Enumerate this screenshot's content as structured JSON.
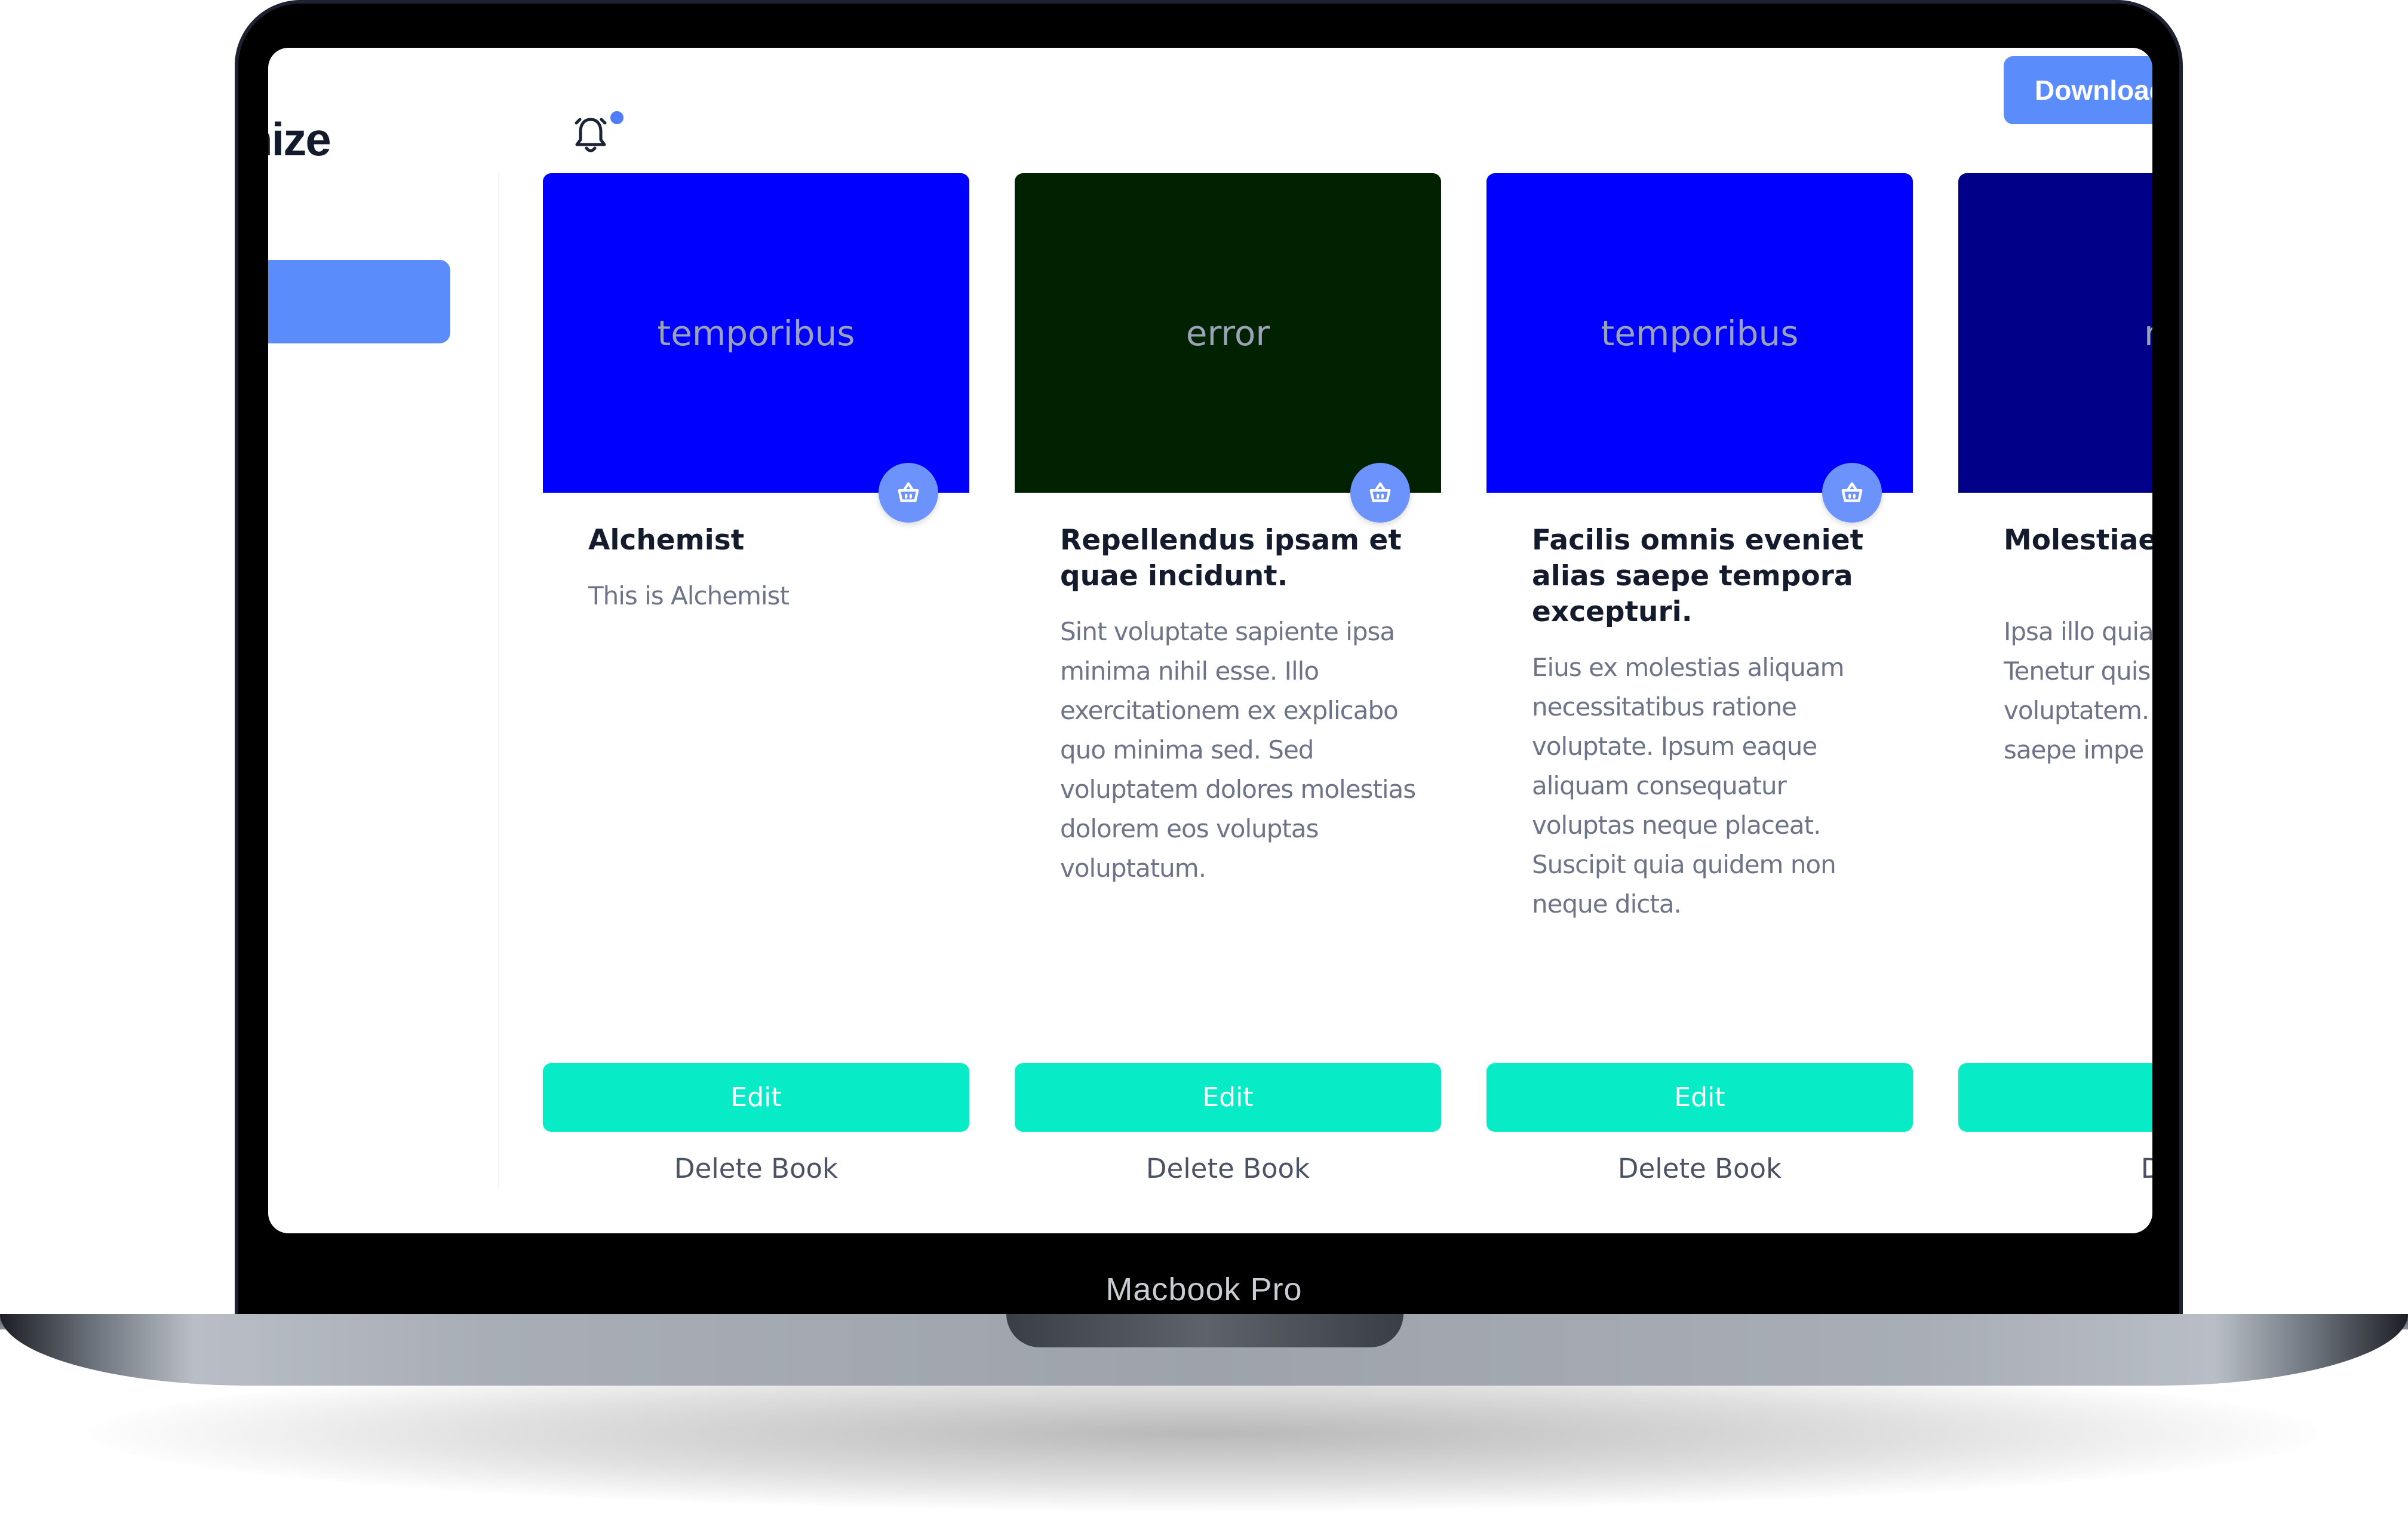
{
  "device": {
    "label": "Macbook Pro"
  },
  "header": {
    "brand": "nize",
    "download_label": "Download",
    "bell_icon": "bell-icon"
  },
  "colors": {
    "primary": "#5a8dfb",
    "accent": "#07ebc6",
    "title": "#141b2d",
    "muted": "#6d7488"
  },
  "books": [
    {
      "cover_text": "temporibus",
      "cover_color": "#0000ff",
      "title": "Alchemist",
      "description": "This is Alchemist",
      "edit_label": "Edit",
      "delete_label": "Delete Book"
    },
    {
      "cover_text": "error",
      "cover_color": "#002200",
      "title": "Repellendus ipsam et quae incidunt.",
      "description": "Sint voluptate sapiente ipsa minima nihil esse. Illo exercitationem ex explicabo quo minima sed. Sed voluptatem dolores molestias dolorem eos voluptas voluptatum.",
      "edit_label": "Edit",
      "delete_label": "Delete Book"
    },
    {
      "cover_text": "temporibus",
      "cover_color": "#0000ff",
      "title": "Facilis omnis eveniet alias saepe tempora excepturi.",
      "description": "Eius ex molestias aliquam necessitatibus ratione voluptate. Ipsum eaque aliquam consequatur voluptas neque placeat. Suscipit quia quidem non neque dicta.",
      "edit_label": "Edit",
      "delete_label": "Delete Book"
    },
    {
      "cover_text": "ma",
      "cover_color": "#000088",
      "title": "Molestiae dolorem.",
      "description": "Ipsa illo quia necessitatib Tenetur quis accusamus voluptatem. consequunt saepe impe",
      "edit_label": "E",
      "delete_label": "Dele"
    }
  ]
}
